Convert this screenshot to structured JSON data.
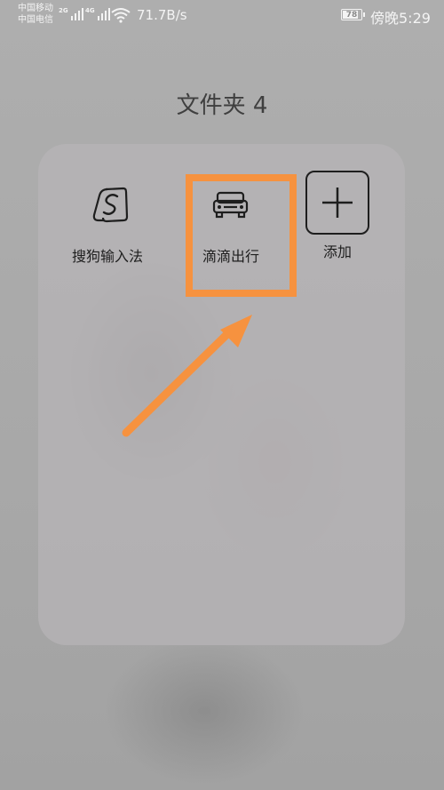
{
  "status_bar": {
    "carrier_1": "中国移动",
    "carrier_2": "中国电信",
    "sim1_tag": "2G",
    "sim2_tag": "4G",
    "net_speed": "71.7B/s",
    "battery_level": "78",
    "time": "傍晚5:29"
  },
  "folder": {
    "title": "文件夹 4",
    "apps": [
      {
        "label": "搜狗输入法",
        "icon": "sogou-input-icon"
      },
      {
        "label": "滴滴出行",
        "icon": "didi-car-icon"
      },
      {
        "label": "添加",
        "icon": "plus-icon"
      }
    ]
  },
  "annotation": {
    "highlight_color": "#f6923f",
    "target": "滴滴出行"
  }
}
